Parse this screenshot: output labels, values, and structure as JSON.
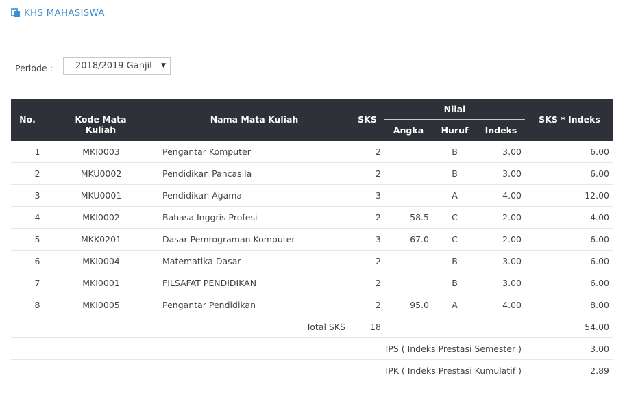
{
  "header": {
    "title": "KHS MAHASISWA",
    "icon": "document-copy-icon"
  },
  "filter": {
    "periode_label": "Periode :",
    "selected": "2018/2019 Ganjil"
  },
  "table": {
    "headers": {
      "no": "No.",
      "kode": "Kode Mata Kuliah",
      "nama": "Nama Mata Kuliah",
      "sks": "SKS",
      "nilai": "Nilai",
      "angka": "Angka",
      "huruf": "Huruf",
      "indeks": "Indeks",
      "sks_indeks": "SKS * Indeks"
    },
    "rows": [
      {
        "no": "1",
        "kode": "MKI0003",
        "nama": "Pengantar Komputer",
        "sks": "2",
        "angka": "",
        "huruf": "B",
        "indeks": "3.00",
        "sks_indeks": "6.00"
      },
      {
        "no": "2",
        "kode": "MKU0002",
        "nama": "Pendidikan Pancasila",
        "sks": "2",
        "angka": "",
        "huruf": "B",
        "indeks": "3.00",
        "sks_indeks": "6.00"
      },
      {
        "no": "3",
        "kode": "MKU0001",
        "nama": "Pendidikan Agama",
        "sks": "3",
        "angka": "",
        "huruf": "A",
        "indeks": "4.00",
        "sks_indeks": "12.00"
      },
      {
        "no": "4",
        "kode": "MKI0002",
        "nama": "Bahasa Inggris Profesi",
        "sks": "2",
        "angka": "58.5",
        "huruf": "C",
        "indeks": "2.00",
        "sks_indeks": "4.00"
      },
      {
        "no": "5",
        "kode": "MKK0201",
        "nama": "Dasar Pemrograman Komputer",
        "sks": "3",
        "angka": "67.0",
        "huruf": "C",
        "indeks": "2.00",
        "sks_indeks": "6.00"
      },
      {
        "no": "6",
        "kode": "MKI0004",
        "nama": "Matematika Dasar",
        "sks": "2",
        "angka": "",
        "huruf": "B",
        "indeks": "3.00",
        "sks_indeks": "6.00"
      },
      {
        "no": "7",
        "kode": "MKI0001",
        "nama": "FILSAFAT PENDIDIKAN",
        "sks": "2",
        "angka": "",
        "huruf": "B",
        "indeks": "3.00",
        "sks_indeks": "6.00"
      },
      {
        "no": "8",
        "kode": "MKI0005",
        "nama": "Pengantar Pendidikan",
        "sks": "2",
        "angka": "95.0",
        "huruf": "A",
        "indeks": "4.00",
        "sks_indeks": "8.00"
      }
    ],
    "summary": {
      "total_sks_label": "Total SKS",
      "total_sks": "18",
      "total_sks_indeks": "54.00",
      "ips_label": "IPS ( Indeks Prestasi Semester )",
      "ips": "3.00",
      "ipk_label": "IPK ( Indeks Prestasi Kumulatif )",
      "ipk": "2.89"
    }
  },
  "colors": {
    "accent": "#3b8ed0",
    "header_bg": "#2e3238"
  }
}
